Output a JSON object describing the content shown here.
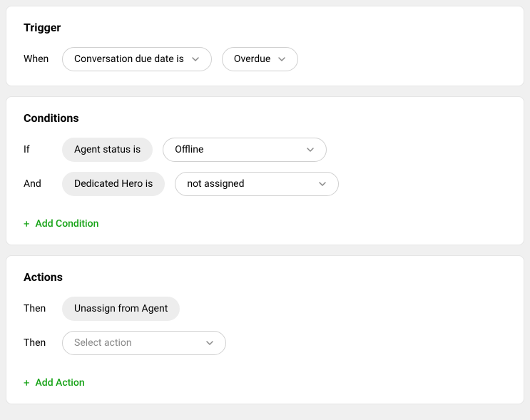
{
  "trigger": {
    "title": "Trigger",
    "prefix": "When",
    "field": "Conversation due date is",
    "value": "Overdue"
  },
  "conditions": {
    "title": "Conditions",
    "rows": [
      {
        "prefix": "If",
        "field": "Agent status is",
        "value": "Offline"
      },
      {
        "prefix": "And",
        "field": "Dedicated Hero is",
        "value": "not assigned"
      }
    ],
    "add_label": "Add Condition"
  },
  "actions": {
    "title": "Actions",
    "rows": [
      {
        "prefix": "Then",
        "field": "Unassign from Agent"
      },
      {
        "prefix": "Then",
        "placeholder": "Select action"
      }
    ],
    "add_label": "Add Action"
  }
}
